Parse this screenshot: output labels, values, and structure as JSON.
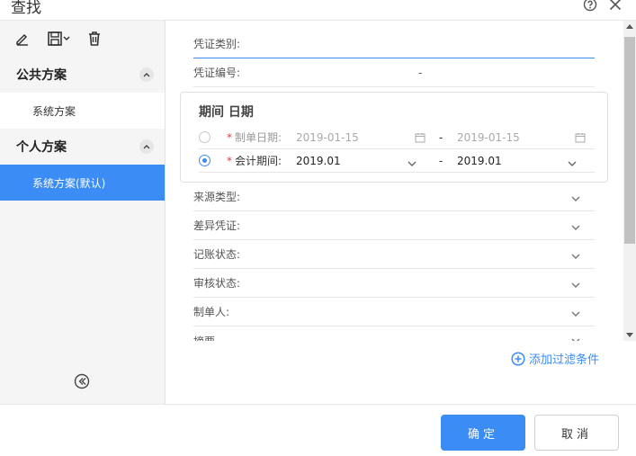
{
  "dialog": {
    "title": "查找"
  },
  "sidebar": {
    "public_group": "公共方案",
    "public_items": [
      "系统方案"
    ],
    "personal_group": "个人方案",
    "personal_items": [
      "系统方案(默认)"
    ]
  },
  "filters": {
    "voucher_type": "凭证类别:",
    "voucher_no": "凭证编号:",
    "voucher_no_sep": "-",
    "source_type": "来源类型:",
    "diff_voucher": "差异凭证:",
    "post_status": "记账状态:",
    "audit_status": "审核状态:",
    "maker": "制单人:",
    "summary": "摘要"
  },
  "period": {
    "title": "期间 日期",
    "required_mark": "*",
    "date_label": "制单日期:",
    "date_from": "2019-01-15",
    "date_to": "2019-01-15",
    "period_label": "会计期间:",
    "period_from": "2019.01",
    "period_to": "2019.01",
    "separator": "-",
    "selected": "period"
  },
  "add_filter": "添加过滤条件",
  "footer": {
    "ok": "确定",
    "cancel": "取消"
  },
  "colors": {
    "accent": "#3c8cf5",
    "required": "#e04040"
  }
}
